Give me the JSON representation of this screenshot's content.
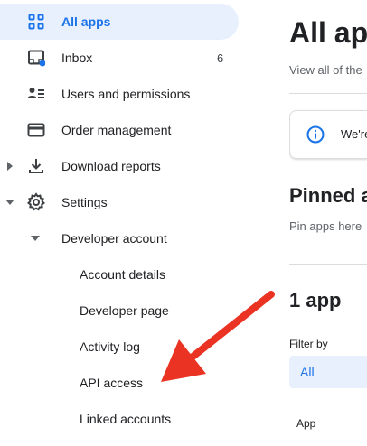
{
  "sidebar": {
    "items": [
      {
        "label": "All apps",
        "icon": "apps-grid-icon",
        "active": true
      },
      {
        "label": "Inbox",
        "icon": "inbox-icon",
        "badge": "6"
      },
      {
        "label": "Users and permissions",
        "icon": "users-icon"
      },
      {
        "label": "Order management",
        "icon": "credit-card-icon"
      },
      {
        "label": "Download reports",
        "icon": "download-icon",
        "expand": "collapsed"
      },
      {
        "label": "Settings",
        "icon": "gear-icon",
        "expand": "expanded"
      },
      {
        "label": "Developer account",
        "expand": "expanded"
      },
      {
        "label": "Account details"
      },
      {
        "label": "Developer page"
      },
      {
        "label": "Activity log"
      },
      {
        "label": "API access"
      },
      {
        "label": "Linked accounts"
      }
    ]
  },
  "main": {
    "title": "All app",
    "subtitle": "View all of the",
    "info_text": "We're",
    "pinned_title": "Pinned a",
    "pinned_sub": "Pin apps here",
    "count_title": "1 app",
    "filter_label": "Filter by",
    "filter_value": "All",
    "column_header": "App"
  },
  "colors": {
    "accent": "#1a73e8",
    "active_bg": "#e8f0fe",
    "annotation_arrow": "#ea3323"
  }
}
